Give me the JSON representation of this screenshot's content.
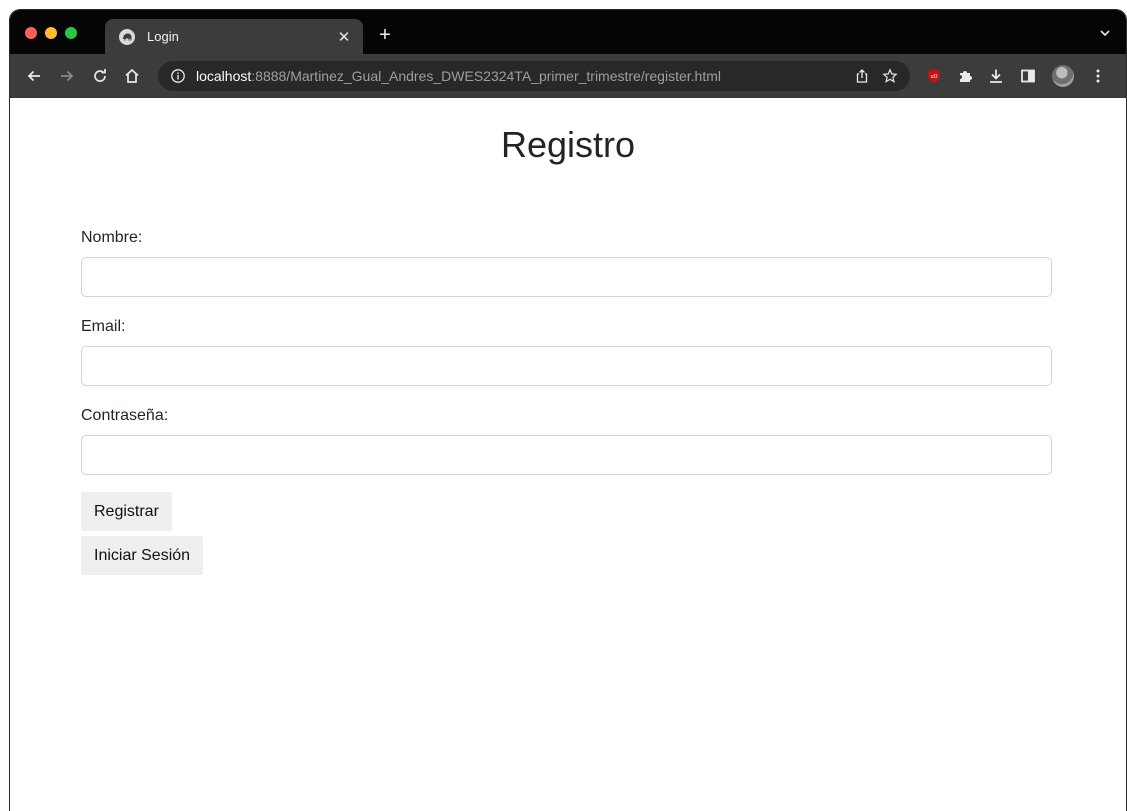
{
  "browser": {
    "tab": {
      "title": "Login",
      "favicon": "elephant-icon",
      "close_glyph": "✕"
    },
    "new_tab_glyph": "+",
    "address": {
      "host": "localhost",
      "path": ":8888/Martinez_Gual_Andres_DWES2324TA_primer_trimestre/register.html"
    },
    "icons": [
      "back-icon",
      "forward-icon",
      "reload-icon",
      "home-icon",
      "info-icon",
      "share-icon",
      "star-icon",
      "ublock-icon",
      "extensions-icon",
      "download-icon",
      "sidepanel-icon",
      "avatar",
      "kebab-menu-icon"
    ],
    "colors": {
      "tabstrip": "#050505",
      "toolbar": "#3c3c3c",
      "omnibox": "#282828",
      "ublock": "#c21414"
    }
  },
  "page": {
    "title": "Registro",
    "fields": [
      {
        "label": "Nombre:",
        "value": "",
        "placeholder": ""
      },
      {
        "label": "Email:",
        "value": "",
        "placeholder": ""
      },
      {
        "label": "Contraseña:",
        "value": "",
        "placeholder": ""
      }
    ],
    "buttons": {
      "register": "Registrar",
      "login": "Iniciar Sesión"
    }
  }
}
